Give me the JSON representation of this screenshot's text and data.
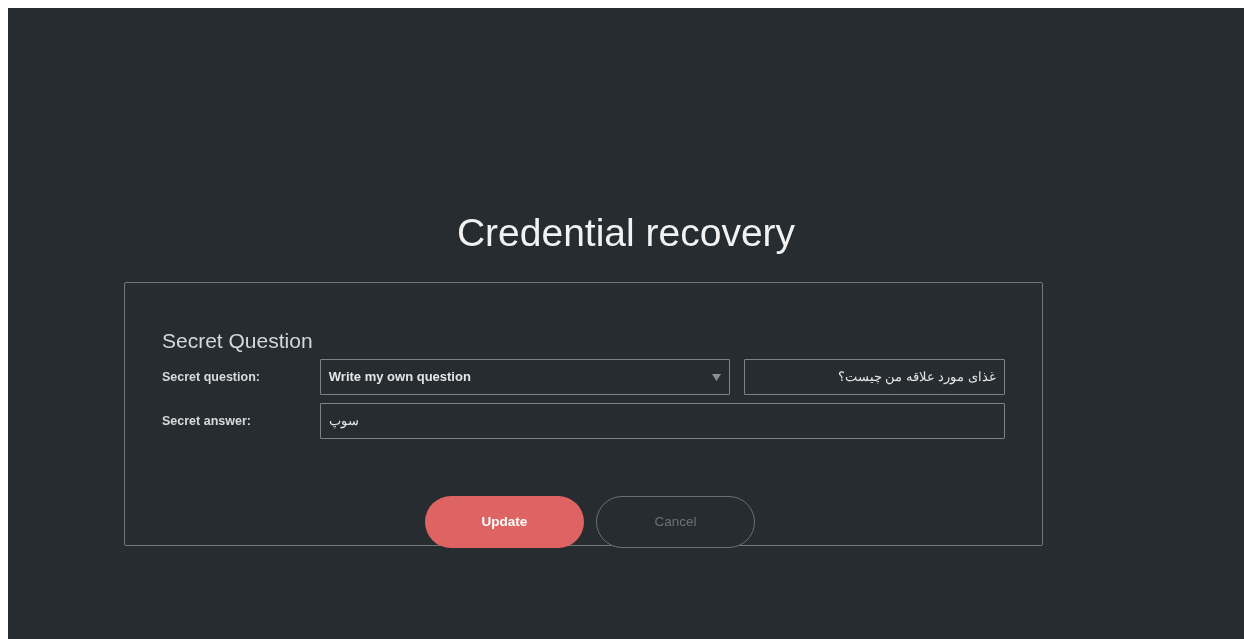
{
  "title": "Credential recovery",
  "section": {
    "heading": "Secret Question",
    "fields": [
      {
        "kind": "select",
        "label": "Secret question:",
        "value": "Write my own question",
        "extra_value": "غذای مورد علاقه من چیست؟"
      },
      {
        "kind": "text",
        "label": "Secret answer:",
        "value": "سوپ"
      }
    ]
  },
  "buttons": [
    {
      "kind": "primary",
      "label": "Update"
    },
    {
      "kind": "outline",
      "label": "Cancel"
    }
  ]
}
